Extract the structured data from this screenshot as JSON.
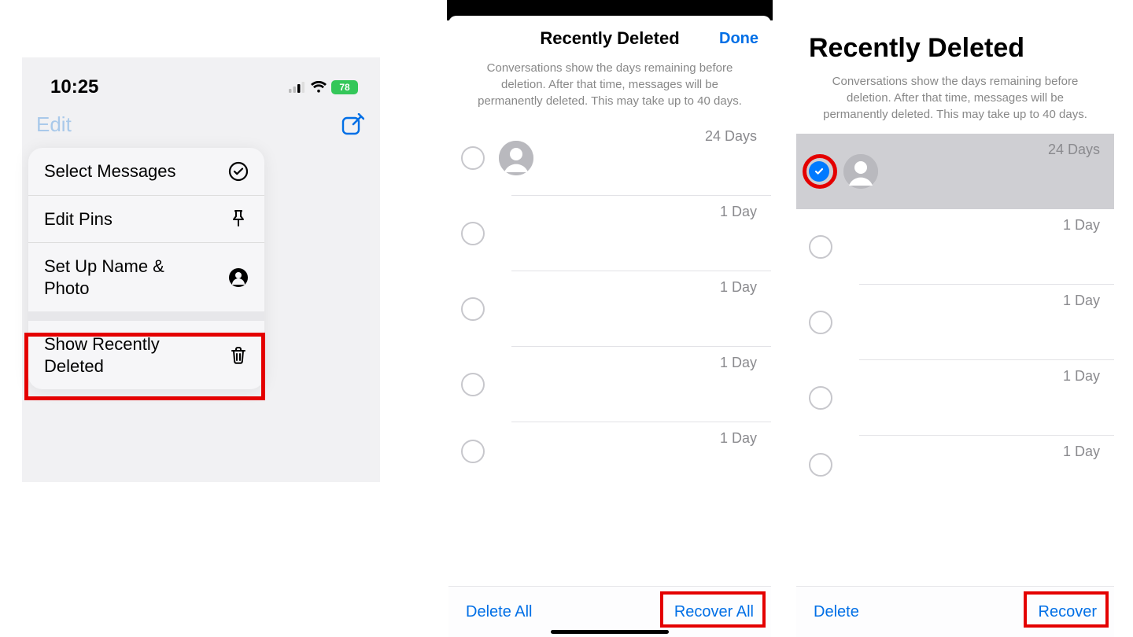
{
  "panel1": {
    "time": "10:25",
    "battery": "78",
    "nav_edit": "Edit",
    "menu": {
      "select_messages": "Select Messages",
      "edit_pins": "Edit Pins",
      "setup_name_photo": "Set Up Name & Photo",
      "show_recently_deleted": "Show Recently Deleted"
    }
  },
  "panel2": {
    "title": "Recently Deleted",
    "done": "Done",
    "description": "Conversations show the days remaining before deletion. After that time, messages will be permanently deleted. This may take up to 40 days.",
    "rows": [
      {
        "days": "24 Days"
      },
      {
        "days": "1 Day"
      },
      {
        "days": "1 Day"
      },
      {
        "days": "1 Day"
      },
      {
        "days": "1 Day"
      }
    ],
    "delete_all": "Delete All",
    "recover_all": "Recover All"
  },
  "panel3": {
    "title": "Recently Deleted",
    "description": "Conversations show the days remaining before deletion. After that time, messages will be permanently deleted. This may take up to 40 days.",
    "rows": [
      {
        "days": "24 Days",
        "selected": true
      },
      {
        "days": "1 Day"
      },
      {
        "days": "1 Day"
      },
      {
        "days": "1 Day"
      },
      {
        "days": "1 Day"
      }
    ],
    "delete": "Delete",
    "recover": "Recover"
  }
}
